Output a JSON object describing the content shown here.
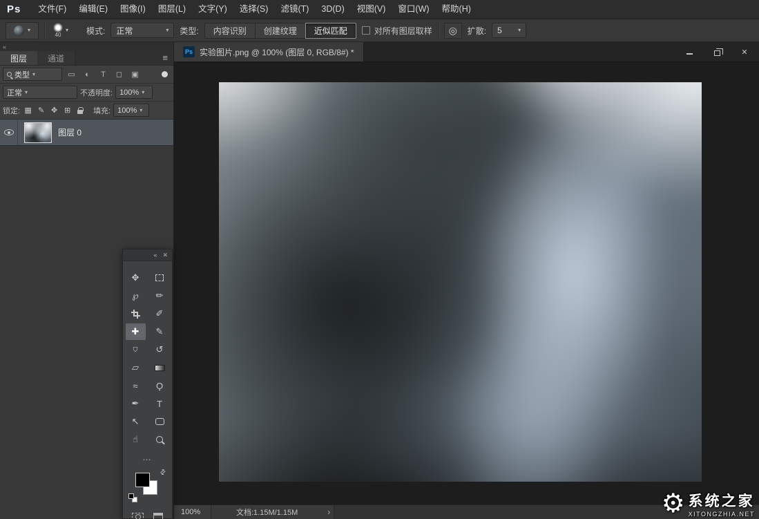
{
  "menu_bar": {
    "logo": "Ps",
    "items": [
      "文件(F)",
      "编辑(E)",
      "图像(I)",
      "图层(L)",
      "文字(Y)",
      "选择(S)",
      "滤镜(T)",
      "3D(D)",
      "视图(V)",
      "窗口(W)",
      "帮助(H)"
    ]
  },
  "options_bar": {
    "brush_size": "40",
    "mode_label": "模式:",
    "mode_value": "正常",
    "type_label": "类型:",
    "type_options": [
      "内容识别",
      "创建纹理",
      "近似匹配"
    ],
    "type_active": "近似匹配",
    "sample_all_layers_label": "对所有图层取样",
    "sample_all_layers_checked": false,
    "diffusion_label": "扩散:",
    "diffusion_value": "5"
  },
  "layers_panel": {
    "tabs": [
      {
        "label": "图层",
        "active": true
      },
      {
        "label": "通道",
        "active": false
      }
    ],
    "filter_value": "类型",
    "filter_icons": [
      "▭",
      "◐",
      "T",
      "◻",
      "▣"
    ],
    "blend_mode_value": "正常",
    "opacity_label": "不透明度:",
    "opacity_value": "100%",
    "lock_label": "锁定:",
    "lock_icons": [
      "▦",
      "✎",
      "✥",
      "⊞"
    ],
    "fill_label": "填充:",
    "fill_value": "100%",
    "layer": {
      "name": "图层 0",
      "visible": true,
      "selected": true
    }
  },
  "toolbox": {
    "tools": [
      {
        "name": "move-tool",
        "glyph": "✥"
      },
      {
        "name": "rect-marquee-tool",
        "glyph": ""
      },
      {
        "name": "lasso-tool",
        "glyph": "℘"
      },
      {
        "name": "quick-selection-tool",
        "glyph": "✏"
      },
      {
        "name": "crop-tool",
        "glyph": ""
      },
      {
        "name": "eyedropper-tool",
        "glyph": "✐"
      },
      {
        "name": "spot-healing-brush-tool",
        "glyph": "✚",
        "active": true
      },
      {
        "name": "brush-tool",
        "glyph": "✎"
      },
      {
        "name": "clone-stamp-tool",
        "glyph": "⌂"
      },
      {
        "name": "history-brush-tool",
        "glyph": "↺"
      },
      {
        "name": "eraser-tool",
        "glyph": "▱"
      },
      {
        "name": "gradient-tool",
        "glyph": ""
      },
      {
        "name": "blur-tool",
        "glyph": "≈"
      },
      {
        "name": "dodge-tool",
        "glyph": "Ϙ"
      },
      {
        "name": "pen-tool",
        "glyph": "✒"
      },
      {
        "name": "type-tool",
        "glyph": "T"
      },
      {
        "name": "path-selection-tool",
        "glyph": "↖"
      },
      {
        "name": "shape-tool",
        "glyph": ""
      },
      {
        "name": "hand-tool",
        "glyph": "☝"
      },
      {
        "name": "zoom-tool",
        "glyph": ""
      }
    ],
    "foreground_color": "#000000",
    "background_color": "#ffffff"
  },
  "document": {
    "file_icon": "Ps",
    "tab_title": "实验图片.png @ 100% (图层 0, RGB/8#) *",
    "status_zoom": "100%",
    "status_doc": "文档:1.15M/1.15M"
  },
  "icons": {
    "chevron_down": "▾",
    "panel_menu": "≡",
    "collapse": "«",
    "close": "✕",
    "swap_colors": "⇄",
    "ellipsis": "⋯",
    "airbrush": "◎",
    "status_chevron": "›",
    "gear": "⚙"
  },
  "watermark": {
    "site_name": "系统之家",
    "site_url": "XITONGZHIA.NET"
  },
  "colors": {
    "canvas_bg": "#1d1d1d",
    "panel_bg": "#3a3a3a",
    "selected_layer_bg": "#50555b",
    "tool_active_bg": "#63666a"
  }
}
